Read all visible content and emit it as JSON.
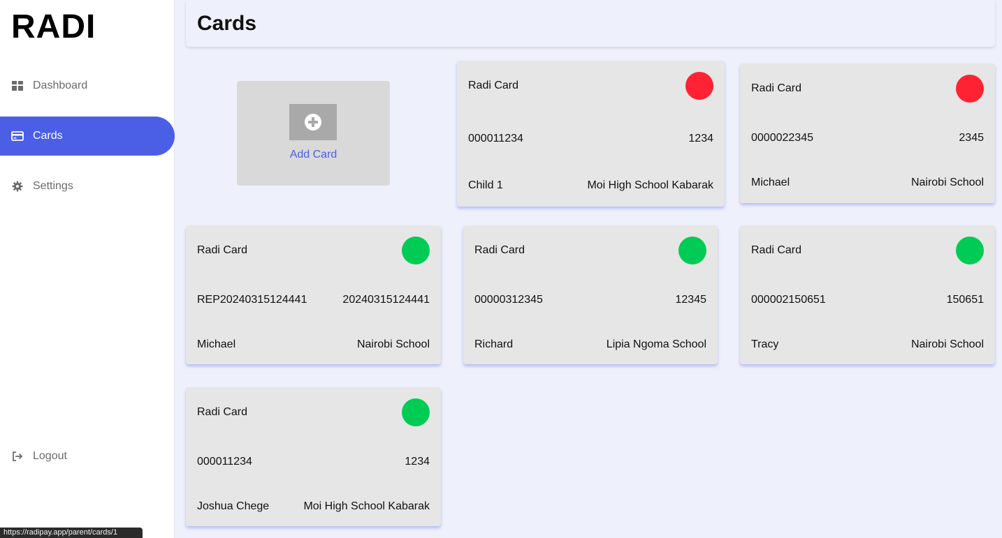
{
  "app": {
    "logo": "RADI",
    "status_url": "https://radipay.app/parent/cards/1"
  },
  "sidebar": {
    "items": [
      {
        "label": "Dashboard",
        "icon": "grid-icon"
      },
      {
        "label": "Cards",
        "icon": "credit-card-icon"
      },
      {
        "label": "Settings",
        "icon": "gear-icon"
      }
    ],
    "logout": {
      "label": "Logout",
      "icon": "logout-icon"
    }
  },
  "header": {
    "title": "Cards"
  },
  "add_card": {
    "label": "Add Card",
    "icon": "plus-circle-icon"
  },
  "colors": {
    "accent": "#4a5fe6",
    "status_inactive": "#ff2233",
    "status_active": "#00cc55"
  },
  "cards": [
    {
      "title": "Radi Card",
      "number": "000011234",
      "code": "1234",
      "holder": "Child 1",
      "school": "Moi High School Kabarak",
      "status_color": "#ff2233"
    },
    {
      "title": "Radi Card",
      "number": "0000022345",
      "code": "2345",
      "holder": "Michael",
      "school": "Nairobi School",
      "status_color": "#ff2233"
    },
    {
      "title": "Radi Card",
      "number": "REP20240315124441",
      "code": "20240315124441",
      "holder": "Michael",
      "school": "Nairobi School",
      "status_color": "#00cc55"
    },
    {
      "title": "Radi Card",
      "number": "00000312345",
      "code": "12345",
      "holder": "Richard",
      "school": "Lipia Ngoma School",
      "status_color": "#00cc55"
    },
    {
      "title": "Radi Card",
      "number": "000002150651",
      "code": "150651",
      "holder": "Tracy",
      "school": "Nairobi School",
      "status_color": "#00cc55"
    },
    {
      "title": "Radi Card",
      "number": "000011234",
      "code": "1234",
      "holder": "Joshua Chege",
      "school": "Moi High School Kabarak",
      "status_color": "#00cc55"
    }
  ]
}
